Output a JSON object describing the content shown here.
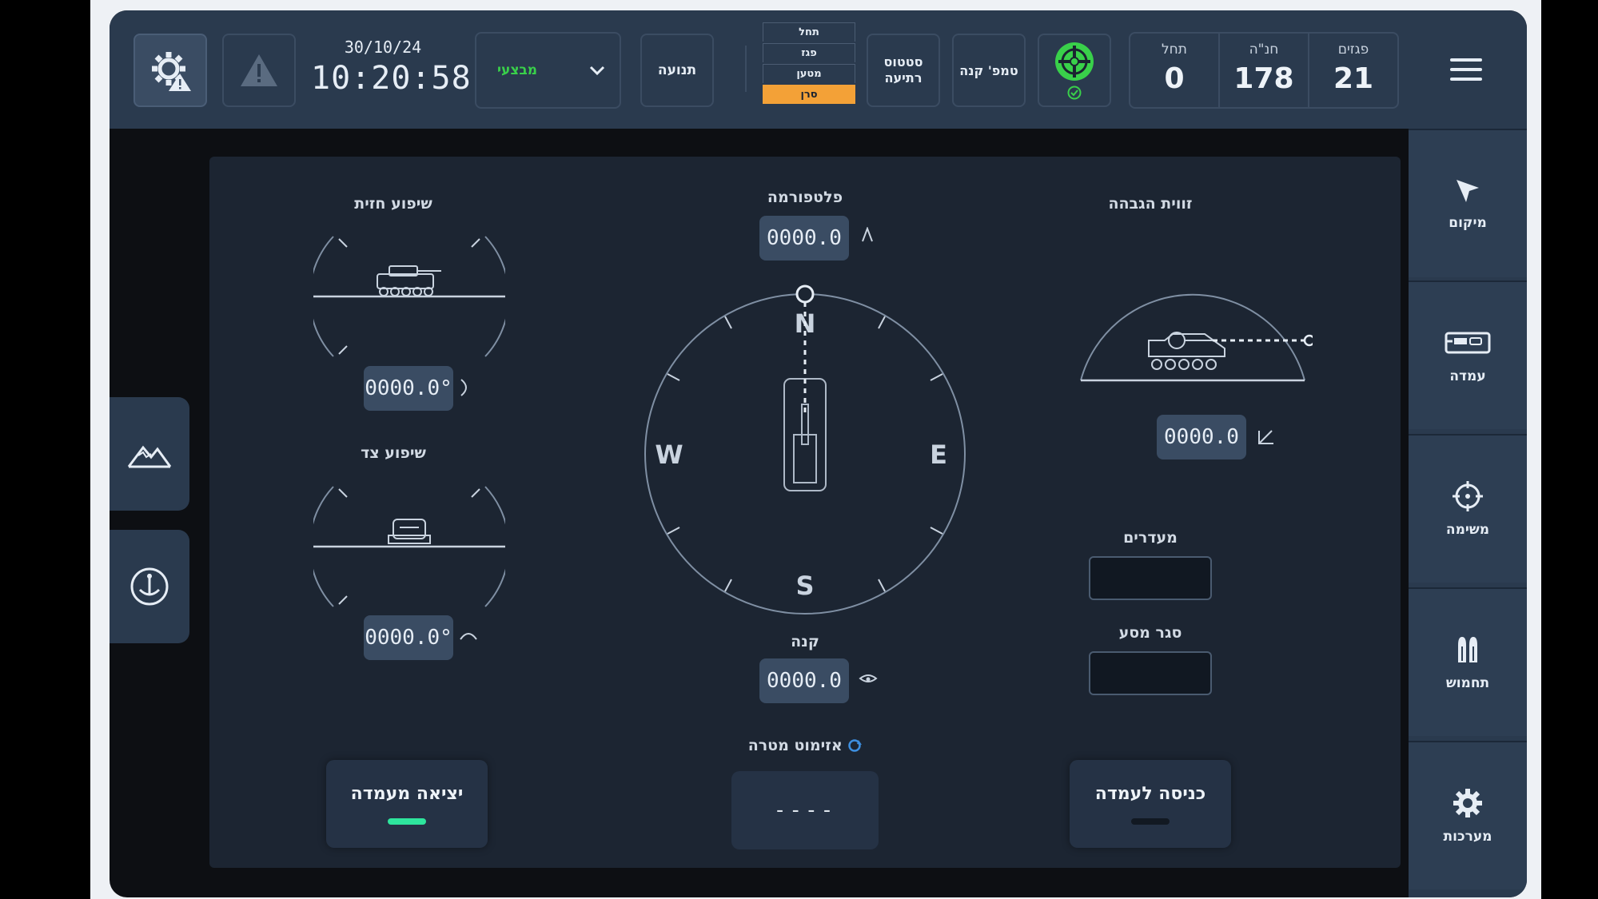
{
  "topbar": {
    "date": "30/10/24",
    "time": "10:20:58",
    "mode_select_value": "מבצעי",
    "motion_label": "תנועה",
    "mode_table": [
      "תחל",
      "פגז",
      "מטען",
      "סרן"
    ],
    "mode_table_active_index": 3,
    "status_label_line1": "סטטוס",
    "status_label_line2": "רתיעה",
    "barrel_temp_label": "טמפ' קנה",
    "counters": [
      {
        "label": "תחל",
        "value": "0"
      },
      {
        "label": "חנ\"ה",
        "value": "178"
      },
      {
        "label": "פגזים",
        "value": "21"
      }
    ]
  },
  "nav": {
    "items": [
      {
        "label": "מיקום",
        "icon": "cursor-arrow-icon"
      },
      {
        "label": "עמדה",
        "icon": "howitzer-icon"
      },
      {
        "label": "משימה",
        "icon": "crosshair-icon"
      },
      {
        "label": "תחמוש",
        "icon": "ammunition-icon"
      },
      {
        "label": "מערכות",
        "icon": "gear-icon"
      }
    ]
  },
  "left_panel": {
    "front_slope_title": "שיפוע חזית",
    "front_slope_value": "0000.0°",
    "side_slope_title": "שיפוע צד",
    "side_slope_value": "0000.0°",
    "exit_position_label": "יציאה מעמדה",
    "exit_indicator_color": "#2ee59d"
  },
  "center_panel": {
    "platform_title": "פלטפורמה",
    "platform_value": "0000.0",
    "compass": {
      "north": "N",
      "south": "S",
      "east": "E",
      "west": "W"
    },
    "barrel_title": "קנה",
    "barrel_value": "0000.0",
    "target_azimuth_label": "אזימוט מטרה",
    "target_azimuth_value": "----"
  },
  "right_panel": {
    "elevation_title": "זווית הגבהה",
    "elevation_value": "0000.0",
    "preferences_label": "מעדרים",
    "travel_lock_label": "סגר מסע",
    "enter_position_label": "כניסה לעמדה",
    "enter_indicator_color": "#1f2935"
  },
  "colors": {
    "accent_green": "#39d04a",
    "active_mode": "#f3a137",
    "panel_bg": "#1c2532",
    "topbar_bg": "#2a3a4e"
  }
}
